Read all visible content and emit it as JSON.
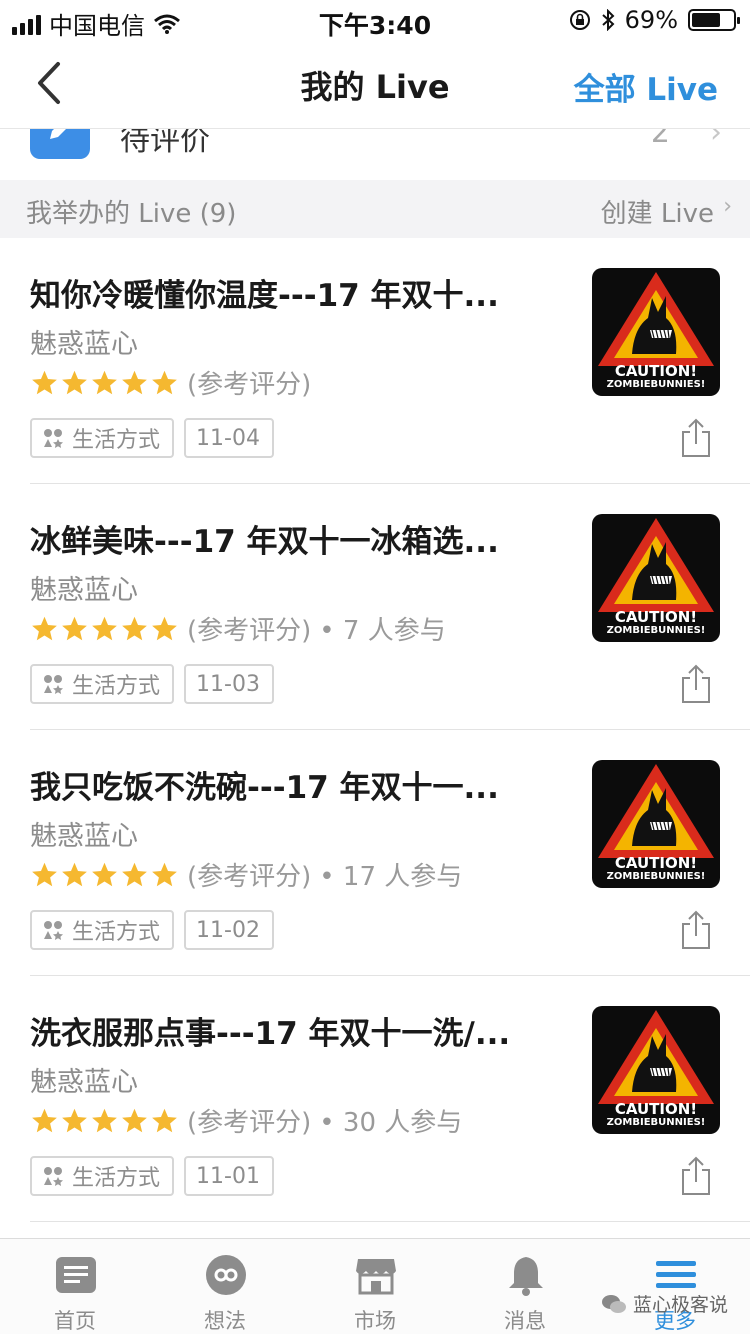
{
  "status_bar": {
    "carrier": "中国电信",
    "time": "下午3:40",
    "battery_percent_label": "69%",
    "battery_level": 0.69
  },
  "nav": {
    "title": "我的 Live",
    "right_action": "全部 Live"
  },
  "pending_row": {
    "label": "待评价",
    "count": "2"
  },
  "section": {
    "title": "我举办的 Live (9)",
    "action": "创建 Live"
  },
  "lives": [
    {
      "title": "知你冷暖懂你温度---17 年双十...",
      "author": "魅惑蓝心",
      "rating_label": "(参考评分)",
      "participants": "",
      "stars": 5,
      "category": "生活方式",
      "date": "11-04"
    },
    {
      "title": "冰鲜美味---17 年双十一冰箱选...",
      "author": "魅惑蓝心",
      "rating_label": "(参考评分)",
      "participants": "• 7 人参与",
      "stars": 5,
      "category": "生活方式",
      "date": "11-03"
    },
    {
      "title": "我只吃饭不洗碗---17 年双十一...",
      "author": "魅惑蓝心",
      "rating_label": "(参考评分)",
      "participants": "• 17 人参与",
      "stars": 5,
      "category": "生活方式",
      "date": "11-02"
    },
    {
      "title": "洗衣服那点事---17 年双十一洗/...",
      "author": "魅惑蓝心",
      "rating_label": "(参考评分)",
      "participants": "• 30 人参与",
      "stars": 5,
      "category": "生活方式",
      "date": "11-01"
    }
  ],
  "cover": {
    "caption_line1": "CAUTION!",
    "caption_line2": "ZOMBIEBUNNIES!"
  },
  "tabs": [
    {
      "label": "首页",
      "icon": "home-icon"
    },
    {
      "label": "想法",
      "icon": "idea-icon"
    },
    {
      "label": "市场",
      "icon": "market-icon"
    },
    {
      "label": "消息",
      "icon": "bell-icon"
    },
    {
      "label": "更多",
      "icon": "menu-icon"
    }
  ],
  "active_tab": 4,
  "watermark": "蓝心极客说",
  "colors": {
    "accent": "#2f8fdc",
    "star": "#f5b830",
    "warning_red": "#d92b1c",
    "warning_yellow": "#f4b400"
  }
}
